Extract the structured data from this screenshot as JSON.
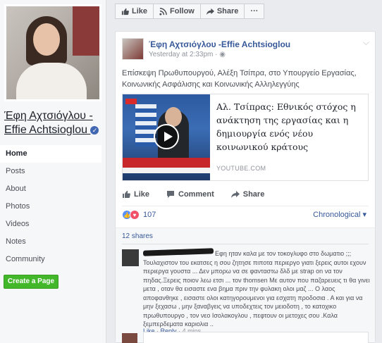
{
  "sidebar": {
    "page_name": "Έφη Αχτσιόγλου - Effie Achtsioglou",
    "nav": [
      "Home",
      "Posts",
      "About",
      "Photos",
      "Videos",
      "Notes",
      "Community"
    ],
    "create_page": "Create a Page"
  },
  "topbar": {
    "like": "Like",
    "follow": "Follow",
    "share": "Share",
    "more": "···"
  },
  "post": {
    "author": "Έφη Αχτσιόγλου -Effie Achtsioglou",
    "time": "Yesterday at 2:33pm · ",
    "text": "Επίσκεψη Πρωθυπουργού, Αλέξη Τσίπρα, στο Υπουργείο Εργασίας, Κοινωνικής Ασφάλισης και Κοινωνικής Αλληλεγγύης",
    "link": {
      "title": "Αλ. Τσίπρας: Εθνικός στόχος η ανάκτηση της εργασίας και η δημιουργία ενός νέου κοινωνικού κράτους",
      "domain": "YOUTUBE.COM"
    },
    "actions": {
      "like": "Like",
      "comment": "Comment",
      "share": "Share"
    },
    "reactions_count": "107",
    "sort": "Chronological ▾",
    "shares": "12 shares",
    "comment": {
      "text": "Εφη ηταν καλα με τον τοκογλυφο στο δωματιο ;;; Τουλαχιστον του εκατσες η σου ζητησε πιποτα περιεργο γιατι ξερεις αυτοι εχουν περιεργα γουστα ... Δεν μπορω να σε φανταστω δλδ με strap on να τον πηδας.Ξερεις ποιον λεω ετσι ... τον thomsen Με αυτον που παζαρευεις τι θα γινει μετα , οταν θα εισαστε ενα βημα πριν την φυλακη ολοι μαζ ... Ο λαος αποφανθηκε , εισαστε ολοι κατηγορουμενοι για εσχατη προδοσια . Α και για να μην ξεχασω , μην ξαναβγεις να υποδεχτεις τον μειοδοτη , το κατοχικο πρωθυπουργο , τον νεο Ισολακογλου , πεφτουν οι μετοχες σου .Καλα ξεμπερδεματα καριολια ..",
      "like": "Like",
      "reply": "Reply",
      "time": "4 mins"
    }
  }
}
